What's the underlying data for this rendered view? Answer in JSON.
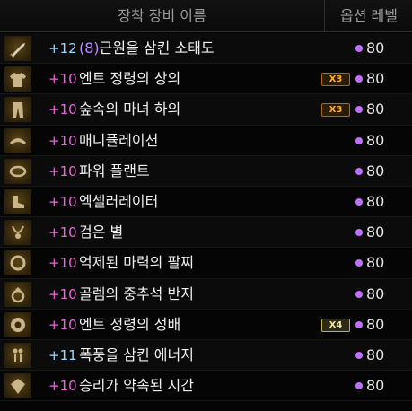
{
  "header": {
    "name_label": "장착 장비 이름",
    "option_label": "옵션 레벨"
  },
  "colors": {
    "enhance_pink": "#e86ad8",
    "enhance_cyan": "#9ad8ff",
    "option_dot": "#c070ff",
    "badge_orange": "#ffb020",
    "badge_gold": "#f4e6a0"
  },
  "items": [
    {
      "slot_icon": "sword-icon",
      "level": "+12",
      "level_color": "cyan",
      "extra": "(8)",
      "name": "근원을 삼킨 소태도",
      "badge": "",
      "option": "80"
    },
    {
      "slot_icon": "coat-icon",
      "level": "+10",
      "level_color": "pink",
      "extra": "",
      "name": "엔트 정령의 상의",
      "badge": "X3",
      "option": "80"
    },
    {
      "slot_icon": "pants-icon",
      "level": "+10",
      "level_color": "pink",
      "extra": "",
      "name": "숲속의 마녀 하의",
      "badge": "X3",
      "option": "80"
    },
    {
      "slot_icon": "shoulder-icon",
      "level": "+10",
      "level_color": "pink",
      "extra": "",
      "name": "매니퓰레이션",
      "badge": "",
      "option": "80"
    },
    {
      "slot_icon": "belt-icon",
      "level": "+10",
      "level_color": "pink",
      "extra": "",
      "name": "파워 플랜트",
      "badge": "",
      "option": "80"
    },
    {
      "slot_icon": "shoes-icon",
      "level": "+10",
      "level_color": "pink",
      "extra": "",
      "name": "엑셀러레이터",
      "badge": "",
      "option": "80"
    },
    {
      "slot_icon": "necklace-icon",
      "level": "+10",
      "level_color": "pink",
      "extra": "",
      "name": "검은 별",
      "badge": "",
      "option": "80"
    },
    {
      "slot_icon": "bracelet-icon",
      "level": "+10",
      "level_color": "pink",
      "extra": "",
      "name": "억제된 마력의 팔찌",
      "badge": "",
      "option": "80"
    },
    {
      "slot_icon": "ring-icon",
      "level": "+10",
      "level_color": "pink",
      "extra": "",
      "name": "골렘의 중추석 반지",
      "badge": "",
      "option": "80"
    },
    {
      "slot_icon": "support-icon",
      "level": "+10",
      "level_color": "pink",
      "extra": "",
      "name": "엔트 정령의 성배",
      "badge": "X4",
      "option": "80"
    },
    {
      "slot_icon": "earring-icon",
      "level": "+11",
      "level_color": "cyan",
      "extra": "",
      "name": "폭풍을 삼킨 에너지",
      "badge": "",
      "option": "80"
    },
    {
      "slot_icon": "magic-stone-icon",
      "level": "+10",
      "level_color": "pink",
      "extra": "",
      "name": "승리가 약속된 시간",
      "badge": "",
      "option": "80"
    }
  ]
}
